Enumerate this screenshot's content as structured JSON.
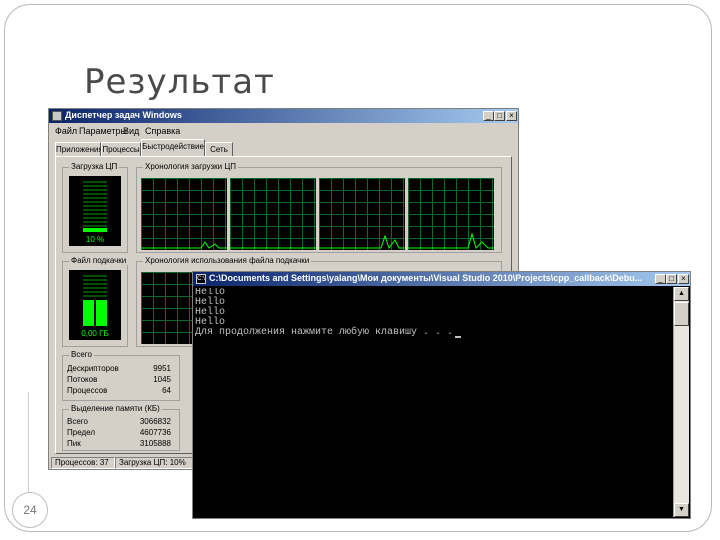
{
  "slide": {
    "title": "Результат",
    "page_number": "24"
  },
  "taskmgr": {
    "title": "Диспетчер задач Windows",
    "menu": [
      "Файл",
      "Параметры",
      "Вид",
      "Справка"
    ],
    "tabs": [
      "Приложения",
      "Процессы",
      "Быстродействие",
      "Сеть"
    ],
    "active_tab": "Быстродействие",
    "cpu_group": "Загрузка ЦП",
    "cpu_value": "10 %",
    "cpu_history_group": "Хронология загрузки ЦП",
    "pf_group": "Файл подкачки",
    "pf_value": "0,00 ГБ",
    "pf_history_group": "Хронология использования файла подкачки",
    "totals_group": "Всего",
    "totals": [
      {
        "label": "Дескрипторов",
        "value": "9951"
      },
      {
        "label": "Потоков",
        "value": "1045"
      },
      {
        "label": "Процессов",
        "value": "64"
      }
    ],
    "memory_group": "Выделение памяти (КБ)",
    "memory": [
      {
        "label": "Всего",
        "value": "3066832"
      },
      {
        "label": "Предел",
        "value": "4607736"
      },
      {
        "label": "Пик",
        "value": "3105888"
      }
    ],
    "status_processes": "Процессов: 37",
    "status_cpu": "Загрузка ЦП: 10%"
  },
  "console": {
    "title": "C:\\Documents and Settings\\yalang\\Мои документы\\Visual Studio 2010\\Projects\\cpp_callback\\Debu...",
    "icon_label": "C:\\",
    "lines": [
      "Hello",
      "Hello",
      "Hello",
      "Hello",
      "Для продолжения нажмите любую клавишу . . ."
    ]
  },
  "colors": {
    "graph_line": "#00ff00",
    "graph_grid": "#0a6a2a",
    "titlebar_start": "#0a246a",
    "titlebar_end": "#a6caf0",
    "console_text": "#c0c0c0"
  }
}
